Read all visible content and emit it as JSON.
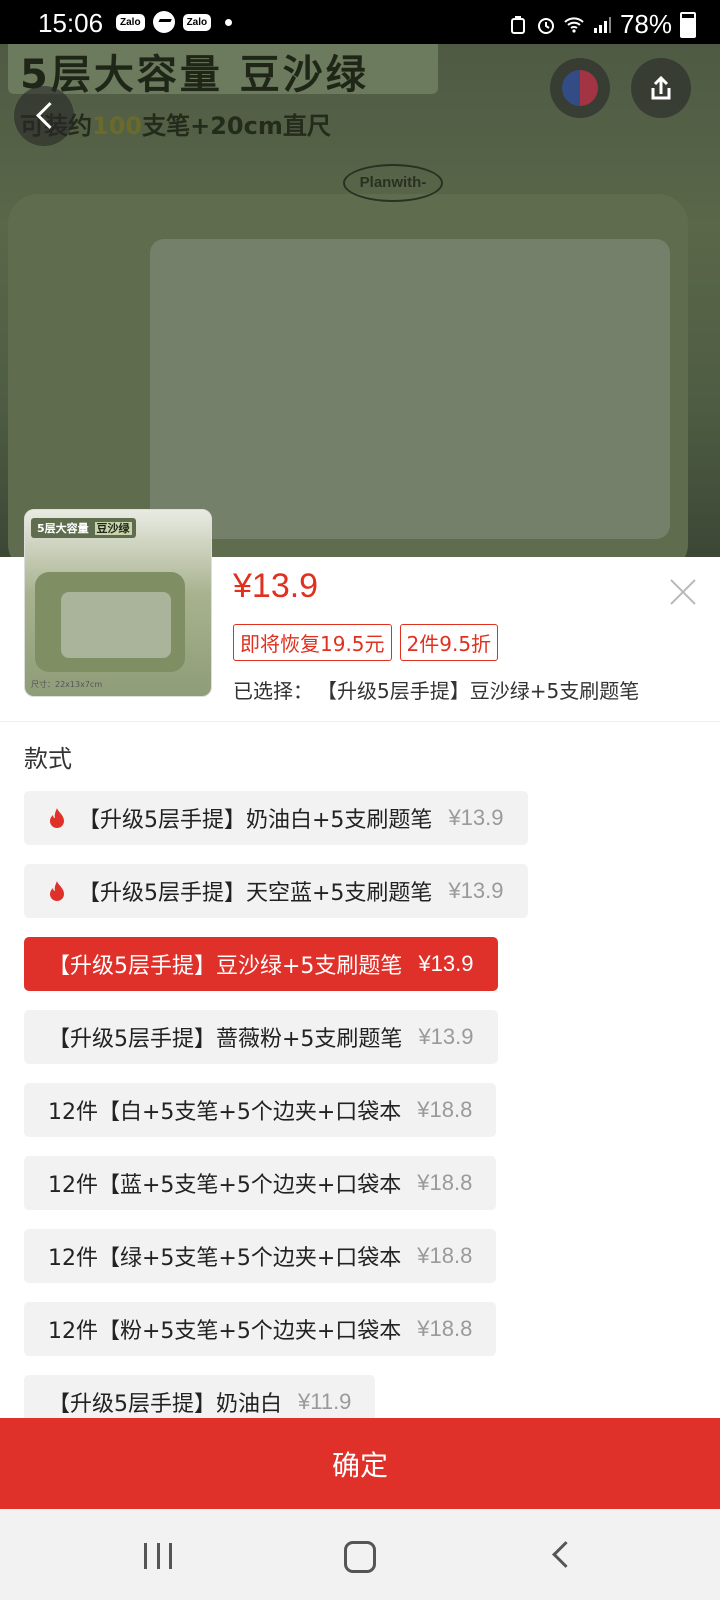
{
  "status": {
    "time": "15:06",
    "apps": [
      "Zalo",
      "Messenger",
      "Zalo"
    ],
    "battery": "78%"
  },
  "hero": {
    "banner": "5层大容量 豆沙绿",
    "sub_prefix": "可装约",
    "sub_highlight": "100",
    "sub_suffix": "支笔+20cm直尺",
    "brand": "Planwith-"
  },
  "thumb": {
    "banner_main": "5层大容量",
    "banner_tag": "豆沙绿",
    "footnote": "尺寸：22x13x7cm"
  },
  "product": {
    "price": "¥13.9",
    "tags": [
      "即将恢复19.5元",
      "2件9.5折"
    ],
    "selected_label": "已选择：",
    "selected_value": "【升级5层手提】豆沙绿+5支刷题笔"
  },
  "section_title": "款式",
  "options": [
    {
      "label": "【升级5层手提】奶油白+5支刷题笔",
      "price": "¥13.9",
      "hot": true,
      "active": false
    },
    {
      "label": "【升级5层手提】天空蓝+5支刷题笔",
      "price": "¥13.9",
      "hot": true,
      "active": false
    },
    {
      "label": "【升级5层手提】豆沙绿+5支刷题笔",
      "price": "¥13.9",
      "hot": false,
      "active": true
    },
    {
      "label": "【升级5层手提】蔷薇粉+5支刷题笔",
      "price": "¥13.9",
      "hot": false,
      "active": false
    },
    {
      "label": "12件【白+5支笔+5个边夹+口袋本",
      "price": "¥18.8",
      "hot": false,
      "active": false
    },
    {
      "label": "12件【蓝+5支笔+5个边夹+口袋本",
      "price": "¥18.8",
      "hot": false,
      "active": false
    },
    {
      "label": "12件【绿+5支笔+5个边夹+口袋本",
      "price": "¥18.8",
      "hot": false,
      "active": false
    },
    {
      "label": "12件【粉+5支笔+5个边夹+口袋本",
      "price": "¥18.8",
      "hot": false,
      "active": false
    },
    {
      "label": "【升级5层手提】奶油白",
      "price": "¥11.9",
      "hot": false,
      "active": false
    }
  ],
  "confirm_label": "确定",
  "colors": {
    "accent": "#e0302a",
    "option_bg": "#f2f2f2",
    "price_grey": "#9a9a9a"
  }
}
